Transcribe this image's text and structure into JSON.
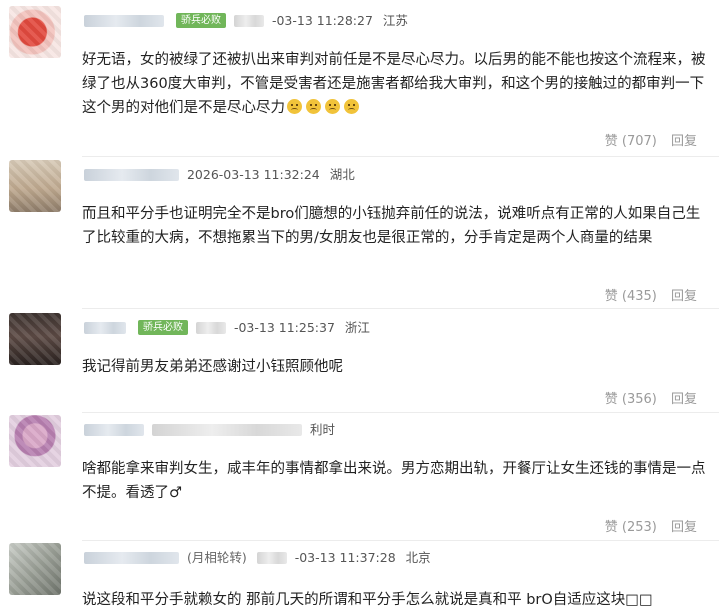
{
  "comments": [
    {
      "badge": "骄兵必败",
      "datetime": "-03-13 11:28:27",
      "location": "江苏",
      "text": "好无语，女的被绿了还被扒出来审判对前任是不是尽心尽力。以后男的能不能也按这个流程来，被绿了也从360度大审判，不管是受害者还是施害者都给我大审判，和这个男的接触过的都审判一下这个男的对他们是不是尽心尽力",
      "emoji_count": 4,
      "likes": "赞 (707)",
      "reply": "回复"
    },
    {
      "datetime": "2026-03-13 11:32:24",
      "location": "湖北",
      "text": "而且和平分手也证明完全不是bro们臆想的小钰抛弃前任的说法，说难听点有正常的人如果自己生了比较重的大病，不想拖累当下的男/女朋友也是很正常的，分手肯定是两个人商量的结果",
      "likes": "赞 (435)",
      "reply": "回复"
    },
    {
      "badge": "骄兵必败",
      "datetime": "-03-13 11:25:37",
      "location": "浙江",
      "text": "我记得前男友弟弟还感谢过小钰照顾他呢",
      "likes": "赞 (356)",
      "reply": "回复"
    },
    {
      "tail": "利时",
      "text": "啥都能拿来审判女生，咸丰年的事情都拿出来说。男方恋期出轨，开餐厅让女生还钱的事情是一点不提。看透了♂",
      "likes": "赞 (253)",
      "reply": "回复"
    },
    {
      "tag": "(月相轮转)",
      "datetime": "-03-13 11:37:28",
      "location": "北京",
      "text": "说这段和平分手就赖女的 那前几天的所谓和平分手怎么就说是真和平 brO自适应这块□□"
    }
  ],
  "colors": {
    "badge": "#71b65a",
    "action": "#9a9a9a",
    "text": "#222222"
  }
}
